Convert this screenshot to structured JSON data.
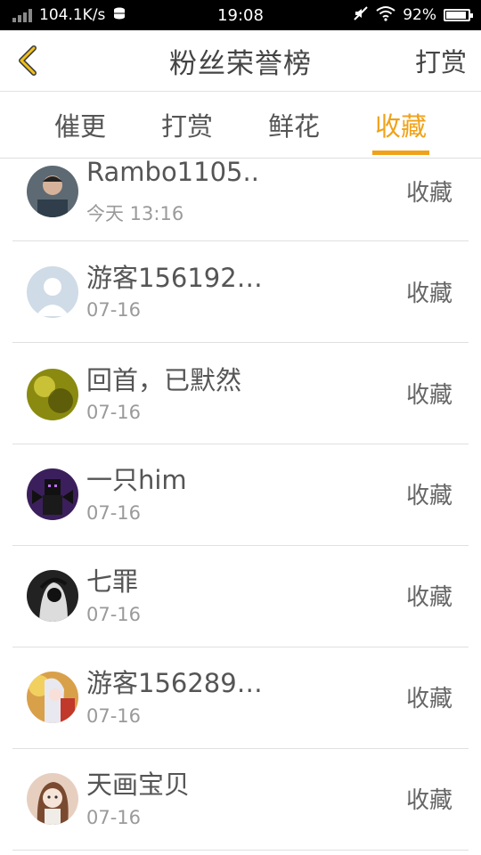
{
  "status_bar": {
    "speed": "104.1K/s",
    "time": "19:08",
    "battery": "92%"
  },
  "header": {
    "title": "粉丝荣誉榜",
    "action": "打赏"
  },
  "tabs": [
    {
      "label": "催更"
    },
    {
      "label": "打赏"
    },
    {
      "label": "鲜花"
    },
    {
      "label": "收藏"
    }
  ],
  "active_tab": "收藏",
  "list": [
    {
      "name": "Rambo1105..",
      "time": "今天 13:16",
      "action": "收藏",
      "avatar_color": "#5d6a73"
    },
    {
      "name": "游客156192…",
      "time": "07-16",
      "action": "收藏",
      "avatar_color": "#cfdbe6"
    },
    {
      "name": "回首，已默然",
      "time": "07-16",
      "action": "收藏",
      "avatar_color": "#8a8a10"
    },
    {
      "name": "一只him",
      "time": "07-16",
      "action": "收藏",
      "avatar_color": "#3b1f5c"
    },
    {
      "name": "七罪",
      "time": "07-16",
      "action": "收藏",
      "avatar_color": "#222222"
    },
    {
      "name": "游客156289…",
      "time": "07-16",
      "action": "收藏",
      "avatar_color": "#d9a04a"
    },
    {
      "name": "天画宝贝",
      "time": "07-16",
      "action": "收藏",
      "avatar_color": "#e7cfc0"
    }
  ],
  "colors": {
    "accent": "#f0a218",
    "text": "#555555",
    "subtext": "#9a9a9a"
  }
}
